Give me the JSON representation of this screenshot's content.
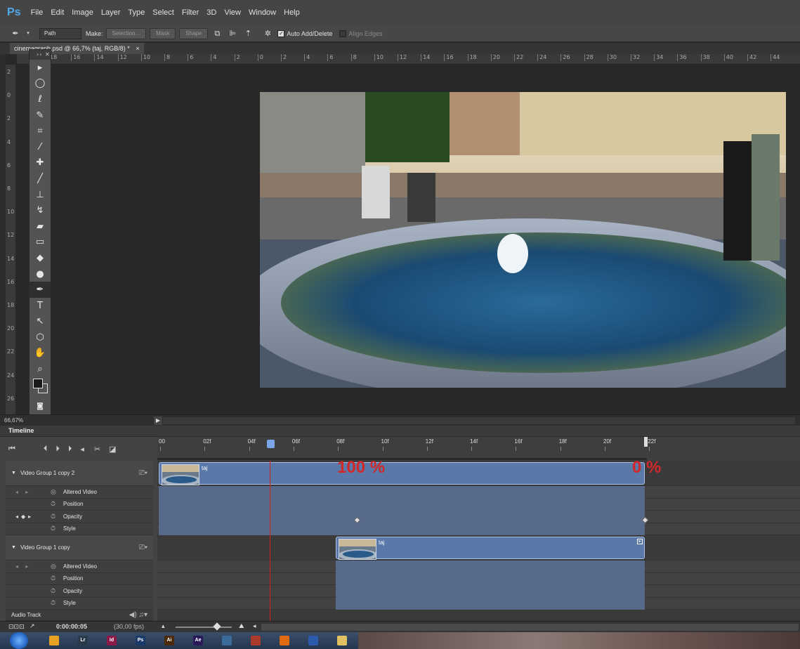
{
  "app": {
    "logo": "Ps"
  },
  "menu": [
    "File",
    "Edit",
    "Image",
    "Layer",
    "Type",
    "Select",
    "Filter",
    "3D",
    "View",
    "Window",
    "Help"
  ],
  "options": {
    "tool_mode": "Path",
    "make_label": "Make:",
    "selection_btn": "Selection...",
    "mask_btn": "Mask",
    "shape_btn": "Shape",
    "auto_add_delete": "Auto Add/Delete",
    "align_edges": "Align Edges"
  },
  "document": {
    "tab_title": "cinemagraph.psd @ 66,7% (taj, RGB/8) *",
    "close_glyph": "×"
  },
  "ruler": {
    "h_labels": [
      "18",
      "16",
      "14",
      "12",
      "10",
      "8",
      "6",
      "4",
      "2",
      "0",
      "2",
      "4",
      "6",
      "8",
      "10",
      "12",
      "14",
      "16",
      "18",
      "20",
      "22",
      "24",
      "26",
      "28",
      "30",
      "32",
      "34",
      "36",
      "38",
      "40",
      "42",
      "44"
    ],
    "v_labels": [
      "2",
      "0",
      "2",
      "4",
      "6",
      "8",
      "1 0",
      "1 2",
      "1 4",
      "1 6",
      "1 8",
      "2 0",
      "2 2",
      "2 4",
      "2 6"
    ]
  },
  "toolbar": {
    "tools": [
      "move-icon",
      "ellipse-marquee-icon",
      "lasso-icon",
      "quick-select-icon",
      "crop-icon",
      "eyedropper-icon",
      "healing-brush-icon",
      "brush-icon",
      "clone-stamp-icon",
      "history-brush-icon",
      "eraser-icon",
      "gradient-icon",
      "blur-icon",
      "dodge-icon",
      "pen-icon",
      "type-icon",
      "path-select-icon",
      "shape-icon",
      "hand-icon",
      "zoom-icon"
    ],
    "active_tool": "pen-icon"
  },
  "status": {
    "zoom": "66,67%"
  },
  "timeline": {
    "title": "Timeline",
    "ruler_labels": [
      "00",
      "02f",
      "04f",
      "06f",
      "08f",
      "10f",
      "12f",
      "14f",
      "16f",
      "18f",
      "20f",
      "22f"
    ],
    "playhead_frame": 5,
    "tracks": [
      {
        "name": "Video Group 1 copy 2",
        "clip_label": "taj",
        "properties": [
          "Altered Video",
          "Position",
          "Opacity",
          "Style"
        ]
      },
      {
        "name": "Video Group 1 copy",
        "clip_label": "taj",
        "properties": [
          "Altered Video",
          "Position",
          "Opacity",
          "Style"
        ]
      }
    ],
    "audio_track": "Audio Track",
    "overlay_start": "100 %",
    "overlay_end": "0 %",
    "current_time": "0:00:00:05",
    "fps": "(30,00 fps)"
  },
  "taskbar": {
    "apps": [
      {
        "name": "media-player",
        "label": "",
        "color": "#e8a020"
      },
      {
        "name": "lightroom",
        "label": "Lr",
        "color": "#2a3a4a"
      },
      {
        "name": "indesign",
        "label": "Id",
        "color": "#8a1a4a"
      },
      {
        "name": "photoshop",
        "label": "Ps",
        "color": "#1a3a6a"
      },
      {
        "name": "illustrator",
        "label": "Ai",
        "color": "#4a2a0a"
      },
      {
        "name": "after-effects",
        "label": "Ae",
        "color": "#2a1a5a"
      },
      {
        "name": "app-7",
        "label": "",
        "color": "#3a6a9a"
      },
      {
        "name": "app-8",
        "label": "",
        "color": "#aa3a2a"
      },
      {
        "name": "firefox",
        "label": "",
        "color": "#e06a10"
      },
      {
        "name": "app-10",
        "label": "",
        "color": "#2a5aaa"
      },
      {
        "name": "explorer",
        "label": "",
        "color": "#e0c060"
      }
    ]
  }
}
